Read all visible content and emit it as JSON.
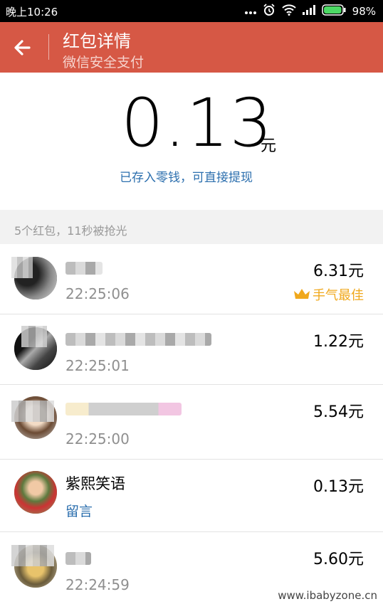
{
  "status_bar": {
    "time": "晚上10:26",
    "battery_percent": "98%",
    "icons": [
      "dots-icon",
      "alarm-icon",
      "wifi-icon",
      "signal-icon",
      "battery-icon"
    ],
    "battery_level": 0.98
  },
  "header": {
    "title": "红包详情",
    "subtitle": "微信安全支付",
    "back_icon": "back-arrow-icon"
  },
  "amount": {
    "value": "0.13",
    "unit": "元",
    "link": "已存入零钱，可直接提现"
  },
  "summary": "5个红包，11秒被抢光",
  "records": [
    {
      "name": "",
      "time": "22:25:06",
      "amount": "6.31元",
      "tag": "手气最佳"
    },
    {
      "name": "",
      "time": "22:25:01",
      "amount": "1.22元"
    },
    {
      "name": "",
      "time": "22:25:00",
      "amount": "5.54元"
    },
    {
      "name": "紫熙笑语",
      "time": "",
      "amount": "0.13元",
      "message": "留言"
    },
    {
      "name": "",
      "time": "22:24:59",
      "amount": "5.60元"
    }
  ],
  "watermark": "www.ibabyzone.cn",
  "colors": {
    "header": "#d65845",
    "link": "#2c6fae",
    "best_tag": "#f0a81c",
    "summary_bg": "#f2f2f2"
  }
}
